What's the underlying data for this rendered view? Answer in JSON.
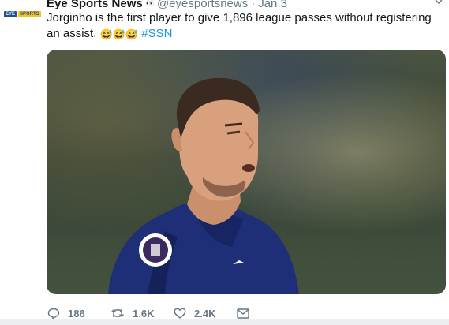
{
  "avatar": {
    "tag_left": "EYE",
    "tag_right": "SPORTS"
  },
  "tweet": {
    "author_name": "Eye Sports News",
    "author_emoji": "👀",
    "handle": "@eyesportsnews",
    "separator": "·",
    "date": "Jan 3",
    "text_line": "Jorginho is the first player to give 1,896 league passes without registering an assist.",
    "emojis": [
      "😅",
      "😅",
      "😅"
    ],
    "hashtag": "#SSN"
  },
  "actions": {
    "replies": "186",
    "retweets": "1.6K",
    "likes": "2.4K"
  },
  "colors": {
    "link": "#1b95e0",
    "secondary_text": "#657786"
  }
}
